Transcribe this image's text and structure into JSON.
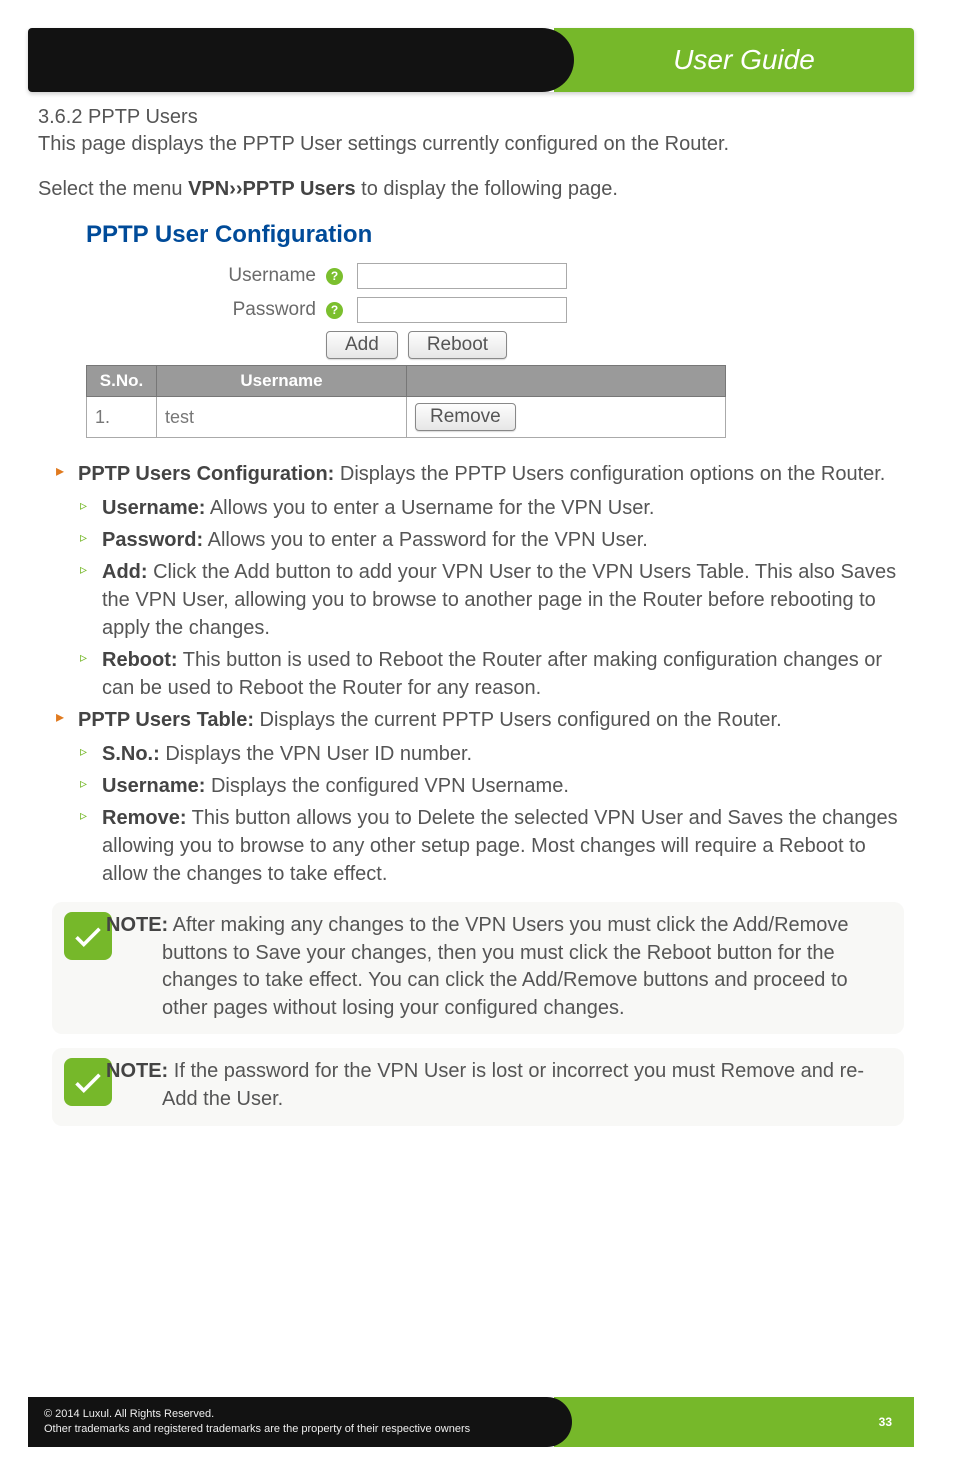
{
  "header": {
    "title": "User Guide"
  },
  "section": {
    "heading": "3.6.2 PPTP Users",
    "intro": "This page displays the PPTP User settings currently configured on the Router.",
    "menu_prefix": "Select the menu ",
    "menu_bold": "VPN››PPTP Users",
    "menu_suffix": " to display the following page."
  },
  "figure": {
    "title": "PPTP User Configuration",
    "labels": {
      "username": "Username",
      "password": "Password"
    },
    "buttons": {
      "add": "Add",
      "reboot": "Reboot",
      "remove": "Remove"
    },
    "table_headers": {
      "sno": "S.No.",
      "username": "Username",
      "action": ""
    },
    "rows": [
      {
        "sno": "1.",
        "username": "test"
      }
    ]
  },
  "defs": {
    "config_title": "PPTP Users Configuration:",
    "config_text": " Displays the PPTP Users configuration options on the Router.",
    "username_t": "Username:",
    "username_d": " Allows you to enter a Username for the VPN User.",
    "password_t": "Password:",
    "password_d": " Allows you to enter a Password for the VPN User.",
    "add_t": "Add:",
    "add_d": " Click the Add button to add your VPN User to the VPN Users Table. This also Saves the VPN User, allowing you to browse to another page in the Router before rebooting to apply the changes.",
    "reboot_t": "Reboot:",
    "reboot_d": " This button is used to Reboot the Router after making configuration changes or can be used to Reboot the Router for any reason.",
    "table_title": "PPTP Users Table:",
    "table_text": " Displays the current PPTP Users configured on the Router.",
    "sno_t": "S.No.:",
    "sno_d": " Displays the VPN User ID number.",
    "uname2_t": "Username:",
    "uname2_d": " Displays the configured VPN Username.",
    "remove_t": "Remove:",
    "remove_d": " This button allows you to Delete the selected VPN User and Saves the changes allowing you to browse to any other setup page. Most changes will require a Reboot to allow the changes to take effect."
  },
  "notes": {
    "n1_label": "NOTE:",
    "n1_text": " After making any changes to the VPN Users you must click the Add/Remove buttons to Save your changes, then you must click the Reboot button for the changes to take effect. You can click the Add/Remove buttons and proceed to other pages without losing your configured changes.",
    "n2_label": "NOTE:",
    "n2_text": " If the password for the VPN User is lost or incorrect you must Remove and re-Add the User."
  },
  "footer": {
    "line1": "© 2014  Luxul. All Rights Reserved.",
    "line2": "Other trademarks and registered trademarks are the property of their respective owners",
    "page": "33"
  }
}
